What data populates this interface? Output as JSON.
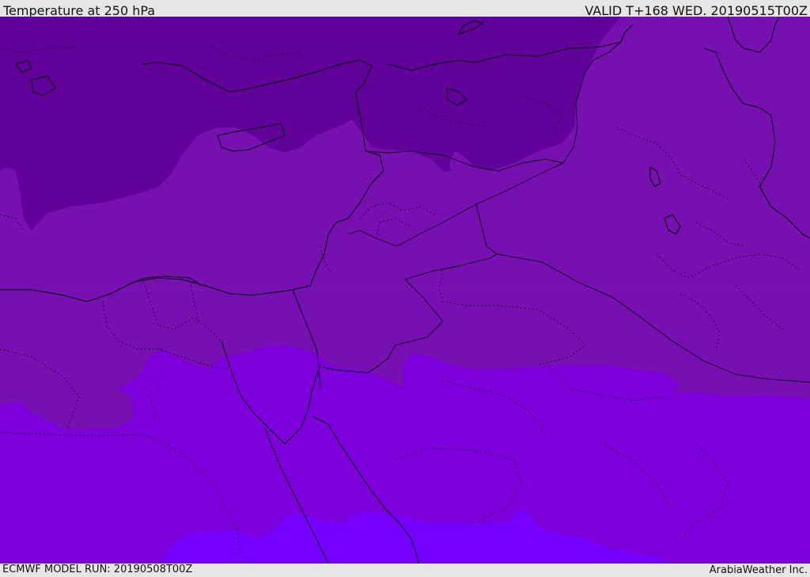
{
  "header": {
    "title": "Temperature at 250 hPa",
    "valid_time": "VALID T+168 WED. 20190515T00Z"
  },
  "footer": {
    "model_run": "ECMWF MODEL RUN: 20190508T00Z",
    "credit": "ArabiaWeather Inc."
  },
  "map": {
    "field": "Temperature at 250 hPa",
    "colors": {
      "band_coldest": "#62009a",
      "band_cold": "#7610b0",
      "band_mid": "#7d00dc",
      "band_warm": "#7600ff",
      "coastline": "#000000",
      "border": "#1a0a2a"
    }
  }
}
